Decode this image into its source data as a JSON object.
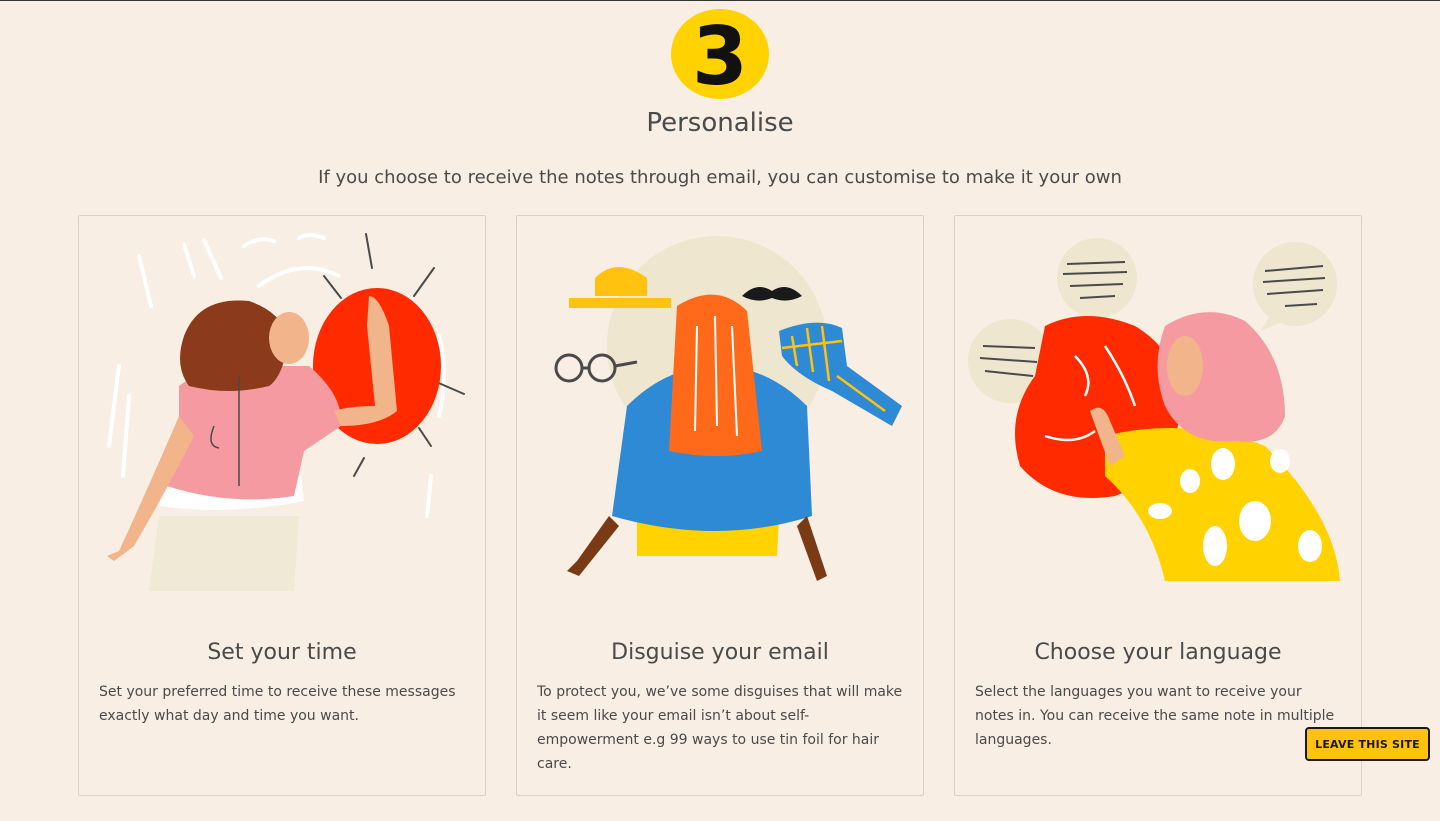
{
  "step": {
    "number": "3",
    "title": "Personalise"
  },
  "intro": "If you choose to receive the notes through email, you can customise to make it your own",
  "cards": [
    {
      "title": "Set your time",
      "text": "Set your preferred time to receive these messages exactly what day and time you want.",
      "illustration": "woman-waving-illustration"
    },
    {
      "title": "Disguise your email",
      "text": "To protect you, we’ve some disguises that will make it seem like your email isn’t about self-empowerment e.g 99 ways to use tin foil for hair care.",
      "illustration": "disguise-items-illustration"
    },
    {
      "title": "Choose your language",
      "text": "Select the languages you want to receive your notes in. You can receive the same note in multiple languages.",
      "illustration": "women-talking-illustration"
    }
  ],
  "leave_button": "LEAVE THIS SITE",
  "colors": {
    "background": "#f8eee3",
    "accent_yellow": "#ffc20e",
    "accent_red": "#ff2a00",
    "pink": "#f59aa0",
    "blue": "#2f8ad6",
    "orange": "#ff6a1a"
  }
}
